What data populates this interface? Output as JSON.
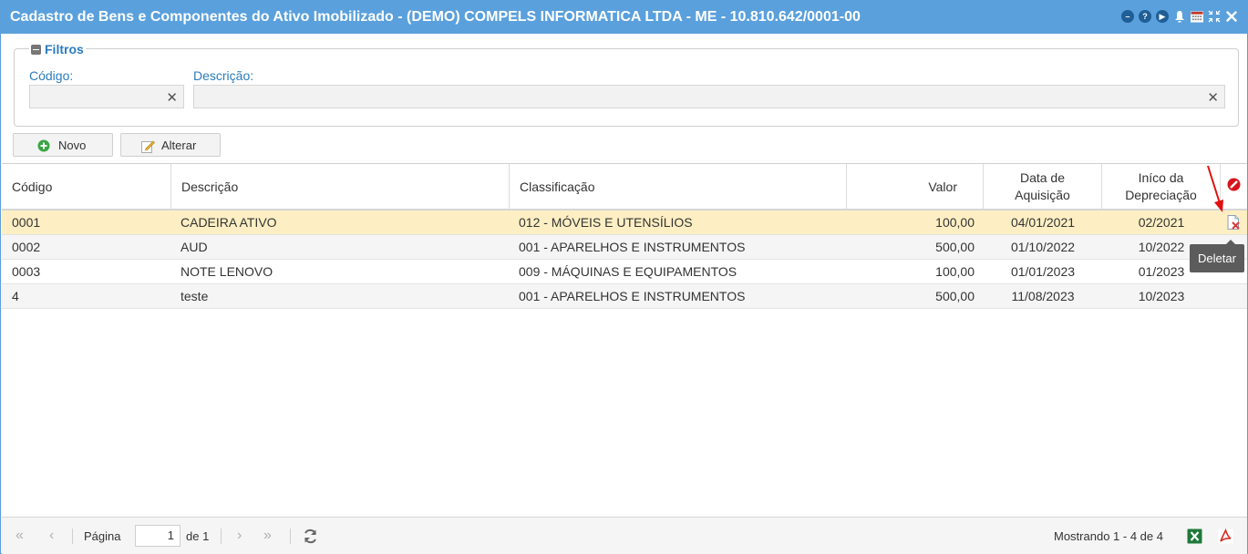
{
  "window": {
    "title": "Cadastro de Bens e Componentes do Ativo Imobilizado - (DEMO) COMPELS INFORMATICA LTDA - ME - 10.810.642/0001-00"
  },
  "filters": {
    "legend": "Filtros",
    "codigo_label": "Código:",
    "codigo_value": "",
    "descricao_label": "Descrição:",
    "descricao_value": ""
  },
  "toolbar": {
    "novo_label": "Novo",
    "alterar_label": "Alterar"
  },
  "grid": {
    "headers": {
      "codigo": "Código",
      "descricao": "Descrição",
      "classificacao": "Classificação",
      "valor": "Valor",
      "data_aquisicao_1": "Data de",
      "data_aquisicao_2": "Aquisição",
      "inicio_depreciacao_1": "Iníco da",
      "inicio_depreciacao_2": "Depreciação"
    },
    "rows": [
      {
        "codigo": "0001",
        "descricao": "CADEIRA ATIVO",
        "classificacao": "012 - MÓVEIS E UTENSÍLIOS",
        "valor": "100,00",
        "data_aquisicao": "04/01/2021",
        "inicio_depreciacao": "02/2021"
      },
      {
        "codigo": "0002",
        "descricao": "AUD",
        "classificacao": "001 - APARELHOS E INSTRUMENTOS",
        "valor": "500,00",
        "data_aquisicao": "01/10/2022",
        "inicio_depreciacao": "10/2022"
      },
      {
        "codigo": "0003",
        "descricao": "NOTE LENOVO",
        "classificacao": "009 - MÁQUINAS E EQUIPAMENTOS",
        "valor": "100,00",
        "data_aquisicao": "01/01/2023",
        "inicio_depreciacao": "01/2023"
      },
      {
        "codigo": "4",
        "descricao": "teste",
        "classificacao": "001 - APARELHOS E INSTRUMENTOS",
        "valor": "500,00",
        "data_aquisicao": "11/08/2023",
        "inicio_depreciacao": "10/2023"
      }
    ],
    "tooltip": "Deletar"
  },
  "pager": {
    "page_label": "Página",
    "page_value": "1",
    "of_label": "de 1",
    "status": "Mostrando 1 - 4 de 4"
  },
  "colors": {
    "titlebar": "#5aa0dc",
    "accent_label": "#2b7cc0",
    "selected_row": "#fdefc3"
  }
}
